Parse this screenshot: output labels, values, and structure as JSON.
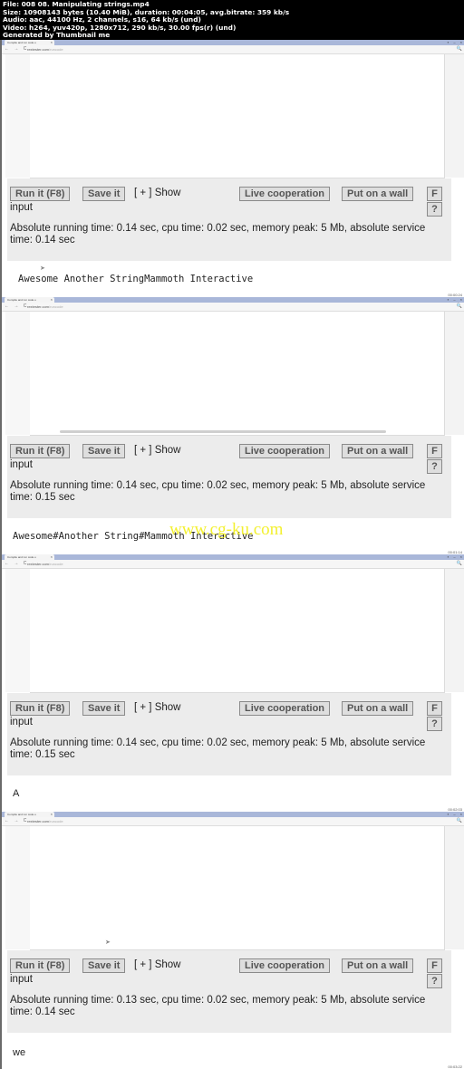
{
  "header": {
    "lines": [
      "File: 008 08. Manipulating strings.mp4",
      "Size: 10908143 bytes (10.40 MiB), duration: 00:04:05, avg.bitrate: 359 kb/s",
      "Audio: aac, 44100 Hz, 2 channels, s16, 64 kb/s (und)",
      "Video: h264, yuv420p, 1280x712, 290 kb/s, 30.00 fps(r) (und)",
      "Generated by Thumbnail me"
    ]
  },
  "browser": {
    "tab_title": "Compile and run code o",
    "tab_close": "×",
    "url_host": "rextester.com",
    "url_path": "/runcode",
    "nav_icons": "← → C",
    "win_controls": "▪ – ×",
    "search_icon": "🔍"
  },
  "controls": {
    "run_label": "Run it (F8)",
    "save_label": "Save it",
    "show_input_prefix": "[ + ] Show",
    "show_input_suffix": "input",
    "live_label": "Live cooperation",
    "wall_label": "Put on a wall",
    "f_label": "F",
    "help_label": "?"
  },
  "frames": [
    {
      "stats": "Absolute running time: 0.14 sec, cpu time: 0.02 sec, memory peak: 5 Mb, absolute service time: 0.14 sec",
      "output": "Awesome Another StringMammoth Interactive",
      "timestamp": "00:00:24"
    },
    {
      "stats": "Absolute running time: 0.14 sec, cpu time: 0.02 sec, memory peak: 5 Mb, absolute service time: 0.15 sec",
      "output": "Awesome#Another String#Mammoth Interactive",
      "timestamp": "00:01:14"
    },
    {
      "stats": "Absolute running time: 0.14 sec, cpu time: 0.02 sec, memory peak: 5 Mb, absolute service time: 0.15 sec",
      "output": "A",
      "timestamp": "00:02:03"
    },
    {
      "stats": "Absolute running time: 0.13 sec, cpu time: 0.02 sec, memory peak: 5 Mb, absolute service time: 0.14 sec",
      "output": "we",
      "timestamp": "00:03:22"
    }
  ],
  "watermark": "www.cg-ku.com"
}
